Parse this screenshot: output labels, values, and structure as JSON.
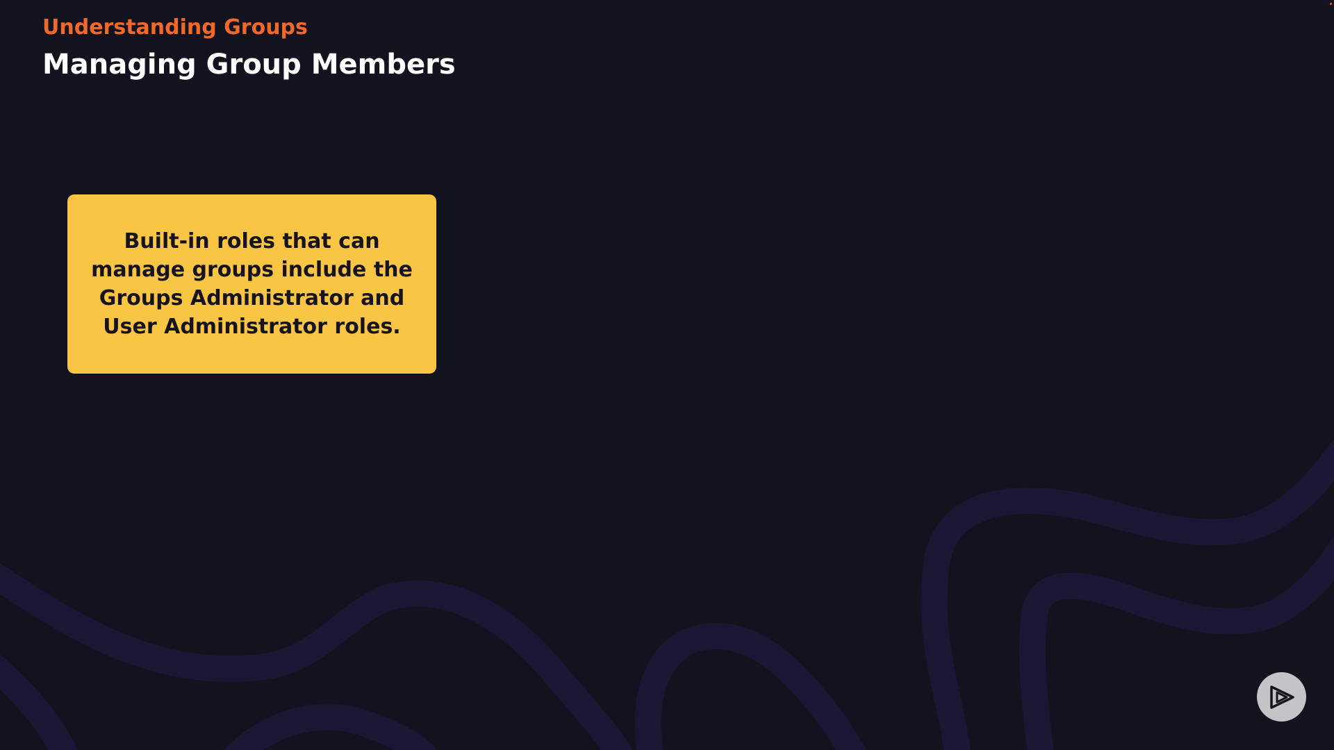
{
  "header": {
    "section": "Understanding Groups",
    "title": "Managing Group Members"
  },
  "callout": {
    "text": "Built-in roles that can manage groups include the Groups Administrator and User Administrator roles."
  },
  "icons": {
    "brand_logo": "play-logo-icon"
  },
  "colors": {
    "background": "#13121f",
    "accent": "#f0692a",
    "callout": "#f8c544",
    "decor": "#1b1633"
  }
}
